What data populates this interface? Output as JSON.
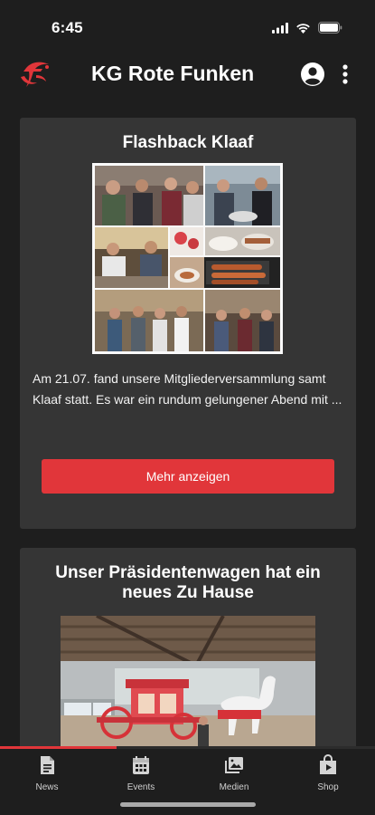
{
  "status_bar": {
    "time": "6:45"
  },
  "app_bar": {
    "title": "KG Rote Funken",
    "icons": [
      "funken-logo-icon",
      "account-circle-icon",
      "more-vert-icon"
    ]
  },
  "posts": [
    {
      "title": "Flashback Klaaf",
      "excerpt": "Am 21.07. fand unsere Mitgliederversammlung samt Klaaf statt. Es war ein rundum gelungener Abend mit ...",
      "button_label": "Mehr anzeigen"
    },
    {
      "title": "Unser Präsidentenwagen hat ein neues Zu Hause"
    }
  ],
  "scroll_progress": 0.31,
  "bottom_nav": {
    "items": [
      {
        "label": "News",
        "icon": "news-icon"
      },
      {
        "label": "Events",
        "icon": "calendar-icon"
      },
      {
        "label": "Medien",
        "icon": "media-icon"
      },
      {
        "label": "Shop",
        "icon": "shop-icon"
      }
    ]
  },
  "colors": {
    "accent": "#e1363a",
    "background": "#1e1e1e",
    "card": "#353535"
  }
}
